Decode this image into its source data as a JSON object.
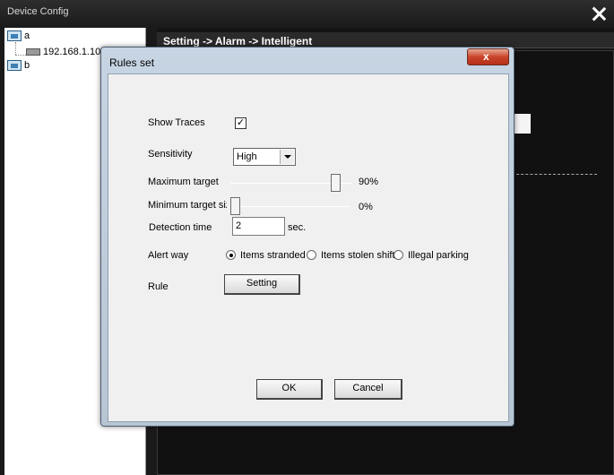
{
  "app": {
    "title": "Device Config"
  },
  "tree": {
    "items": [
      {
        "label": "a"
      },
      {
        "label": "192.168.1.10"
      },
      {
        "label": "b"
      }
    ]
  },
  "content": {
    "breadcrumb": "Setting -> Alarm -> Intelligent"
  },
  "dialog": {
    "title": "Rules set",
    "close_label": "x",
    "show_traces": {
      "label": "Show Traces",
      "checked": true,
      "mark": "✓"
    },
    "sensitivity": {
      "label": "Sensitivity",
      "value": "High"
    },
    "maximum_target": {
      "label": "Maximum target",
      "value_text": "90%",
      "value": 0.9
    },
    "minimum_target": {
      "label": "Minimum target siz",
      "value_text": "0%",
      "value": 0.0
    },
    "detection_time": {
      "label": "Detection time",
      "value": "2",
      "unit": "sec."
    },
    "alert_way": {
      "label": "Alert way",
      "options": [
        {
          "label": "Items stranded",
          "selected": true
        },
        {
          "label": "Items stolen shift",
          "selected": false
        },
        {
          "label": "Illegal parking",
          "selected": false
        }
      ]
    },
    "rule": {
      "label": "Rule",
      "button": "Setting"
    },
    "ok_label": "OK",
    "cancel_label": "Cancel"
  }
}
